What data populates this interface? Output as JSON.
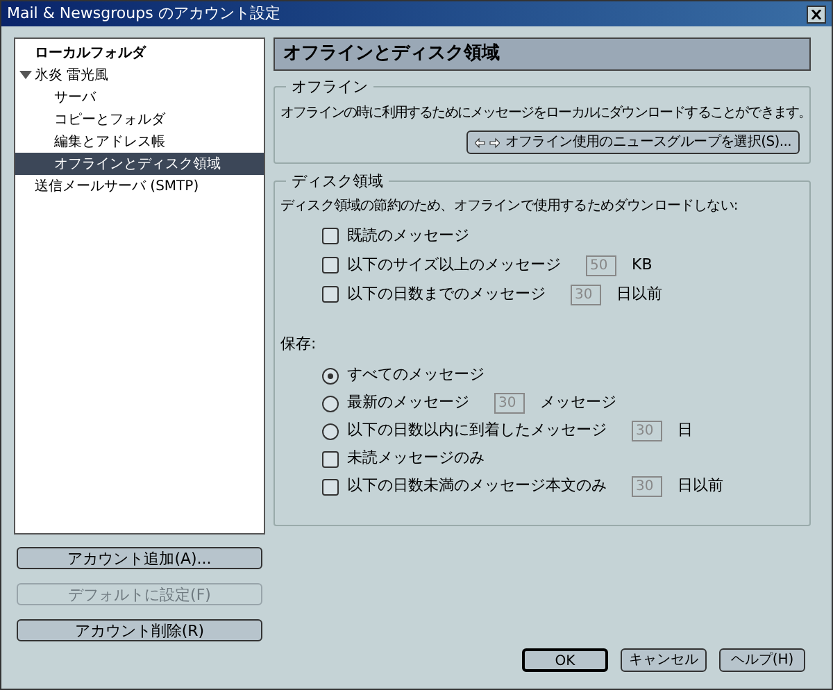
{
  "window": {
    "title": "Mail & Newsgroups のアカウント設定"
  },
  "tree": [
    {
      "label": "ローカルフォルダ",
      "kind": "local",
      "selected": false
    },
    {
      "label": "氷炎  雷光風",
      "kind": "account",
      "selected": false,
      "expanded": true,
      "children": [
        {
          "label": "サーバ",
          "selected": false
        },
        {
          "label": "コピーとフォルダ",
          "selected": false
        },
        {
          "label": "編集とアドレス帳",
          "selected": false
        },
        {
          "label": "オフラインとディスク領域",
          "selected": true
        }
      ]
    },
    {
      "label": "送信メールサーバ (SMTP)",
      "kind": "smtp",
      "selected": false
    }
  ],
  "sidebar_buttons": [
    {
      "label": "アカウント追加(A)...",
      "disabled": false
    },
    {
      "label": "デフォルトに設定(F)",
      "disabled": true
    },
    {
      "label": "アカウント削除(R)",
      "disabled": false
    }
  ],
  "page_title": "オフラインとディスク領域",
  "offline": {
    "title": "オフライン",
    "description": "オフラインの時に利用するためにメッセージをローカルにダウンロードすることができます。",
    "button": "オフライン使用のニュースグループを選択(S)..."
  },
  "disk": {
    "title": "ディスク領域",
    "intro": "ディスク領域の節約のため、オフラインで使用するためダウンロードしない:",
    "download_options": [
      {
        "kind": "checkbox",
        "label": "既読のメッセージ",
        "checked": false
      },
      {
        "kind": "checkbox",
        "label": "以下のサイズ以上のメッセージ",
        "checked": false,
        "value": "50",
        "unit": "KB"
      },
      {
        "kind": "checkbox",
        "label": "以下の日数までのメッセージ",
        "checked": false,
        "value": "30",
        "unit": "日以前"
      }
    ],
    "keep_label": "保存:",
    "keep_options": [
      {
        "kind": "radio",
        "label": "すべてのメッセージ",
        "selected": true
      },
      {
        "kind": "radio",
        "label": "最新のメッセージ",
        "selected": false,
        "value": "30",
        "unit": "メッセージ"
      },
      {
        "kind": "radio",
        "label": "以下の日数以内に到着したメッセージ",
        "selected": false,
        "value": "30",
        "unit": "日"
      },
      {
        "kind": "checkbox",
        "label": "未読メッセージのみ",
        "checked": false
      },
      {
        "kind": "checkbox",
        "label": "以下の日数未満のメッセージ本文のみ",
        "checked": false,
        "value": "30",
        "unit": "日以前"
      }
    ]
  },
  "footer_buttons": [
    {
      "label": "OK",
      "default": true
    },
    {
      "label": "キャンセル",
      "default": false
    },
    {
      "label": "ヘルプ(H)",
      "default": false
    }
  ]
}
